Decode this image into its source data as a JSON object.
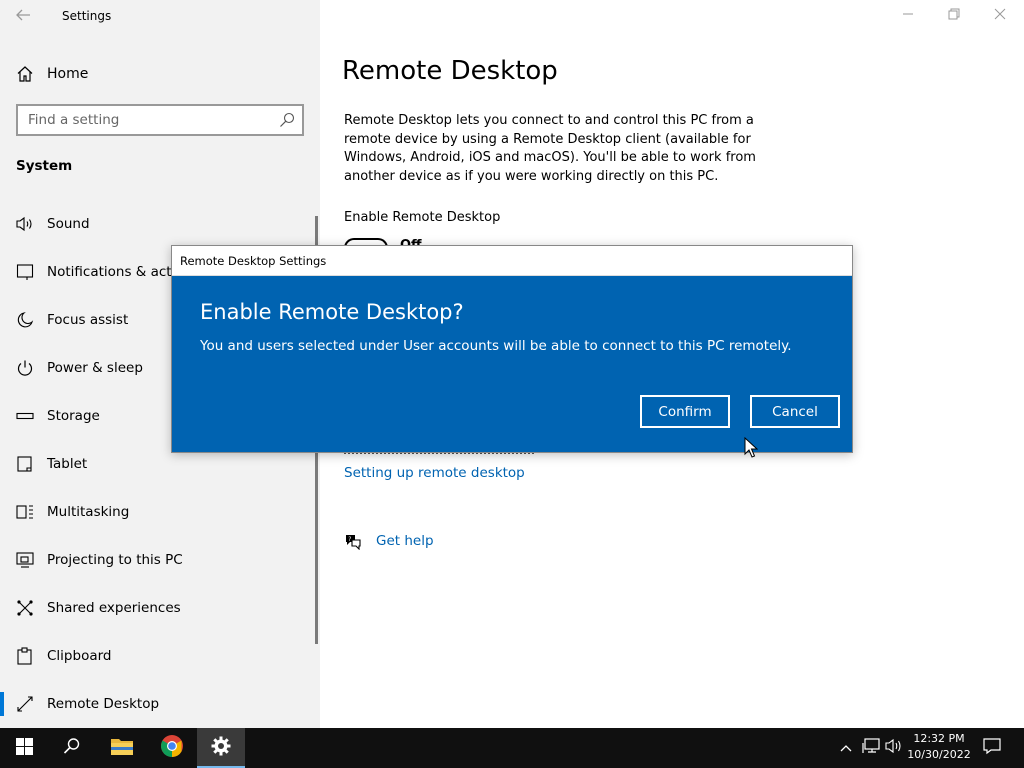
{
  "window": {
    "title": "Settings"
  },
  "sidebar": {
    "home_label": "Home",
    "search_placeholder": "Find a setting",
    "section_title": "System",
    "items": [
      {
        "label": "Sound",
        "icon": "speaker-icon"
      },
      {
        "label": "Notifications & actions",
        "icon": "notification-icon"
      },
      {
        "label": "Focus assist",
        "icon": "moon-icon"
      },
      {
        "label": "Power & sleep",
        "icon": "power-icon"
      },
      {
        "label": "Storage",
        "icon": "storage-icon"
      },
      {
        "label": "Tablet",
        "icon": "tablet-icon"
      },
      {
        "label": "Multitasking",
        "icon": "multitasking-icon"
      },
      {
        "label": "Projecting to this PC",
        "icon": "projecting-icon"
      },
      {
        "label": "Shared experiences",
        "icon": "shared-icon"
      },
      {
        "label": "Clipboard",
        "icon": "clipboard-icon"
      },
      {
        "label": "Remote Desktop",
        "icon": "remote-desktop-icon",
        "active": true
      }
    ]
  },
  "main": {
    "title": "Remote Desktop",
    "description": "Remote Desktop lets you connect to and control this PC from a remote device by using a Remote Desktop client (available for Windows, Android, iOS and macOS). You'll be able to work from another device as if you were working directly on this PC.",
    "enable_label": "Enable Remote Desktop",
    "toggle_state": "Off",
    "link_setup": "Setting up remote desktop",
    "get_help": "Get help"
  },
  "dialog": {
    "title": "Remote Desktop Settings",
    "heading": "Enable Remote Desktop?",
    "text": "You and users selected under User accounts will be able to connect to this PC remotely.",
    "confirm_label": "Confirm",
    "cancel_label": "Cancel"
  },
  "taskbar": {
    "time": "12:32 PM",
    "date": "10/30/2022"
  },
  "colors": {
    "accent": "#0078d7",
    "dialog_bg": "#0063b1",
    "link": "#0063b1",
    "sidebar_bg": "#f2f2f2",
    "taskbar_bg": "#101010"
  }
}
